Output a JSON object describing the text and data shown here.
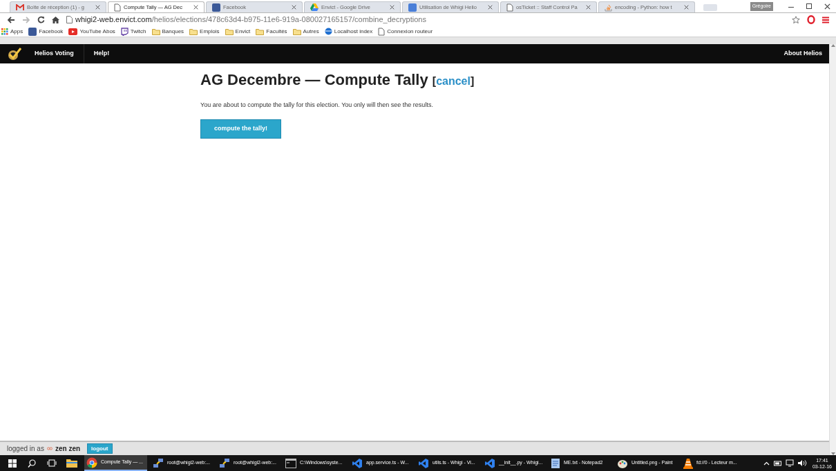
{
  "browser": {
    "tabs": [
      {
        "title": "Boîte de réception (1) - g",
        "kind": "gmail",
        "selected": false
      },
      {
        "title": "Compute Tally — AG Dec",
        "kind": "page",
        "selected": true
      },
      {
        "title": "Facebook",
        "kind": "facebook",
        "selected": false
      },
      {
        "title": "Envict - Google Drive",
        "kind": "drive",
        "selected": false
      },
      {
        "title": "Utilisation de Whigi Helio",
        "kind": "doc",
        "selected": false
      },
      {
        "title": "osTicket :: Staff Control Pa",
        "kind": "page",
        "selected": false
      },
      {
        "title": "encoding - Python: how t",
        "kind": "stack",
        "selected": false
      }
    ],
    "profile": "Grégoire",
    "url_host": "whigi2-web.envict.com",
    "url_path": "/helios/elections/478c63d4-b975-11e6-919a-080027165157/combine_decryptions",
    "bookmarks": [
      {
        "label": "Apps",
        "kind": "apps"
      },
      {
        "label": "Facebook",
        "kind": "facebook"
      },
      {
        "label": "YouTube Abos",
        "kind": "youtube"
      },
      {
        "label": "Twitch",
        "kind": "twitch"
      },
      {
        "label": "Banques",
        "kind": "folder"
      },
      {
        "label": "Emplois",
        "kind": "folder"
      },
      {
        "label": "Envict",
        "kind": "folder"
      },
      {
        "label": "Facultés",
        "kind": "folder"
      },
      {
        "label": "Autres",
        "kind": "folder"
      },
      {
        "label": "Localhost index",
        "kind": "globe"
      },
      {
        "label": "Connexion routeur",
        "kind": "page"
      }
    ]
  },
  "site_nav": {
    "brand": "Helios Voting",
    "links": [
      "Help!"
    ],
    "right": "About Helios"
  },
  "page": {
    "title": "AG Decembre — Compute Tally",
    "cancel_link": "cancel",
    "cancel_open": "[",
    "cancel_close": "]",
    "description": "You are about to compute the tally for this election. You only will then see the results.",
    "button": "compute the tally!"
  },
  "footer": {
    "prefix": "logged in as",
    "user": "zen zen",
    "logout": "logout"
  },
  "taskbar": {
    "items": [
      {
        "label": "Compute Tally — ...",
        "kind": "chrome",
        "selected": true
      },
      {
        "label": "root@whigi2-web:...",
        "kind": "putty",
        "selected": false
      },
      {
        "label": "root@whigi2-web:...",
        "kind": "putty",
        "selected": false
      },
      {
        "label": "C:\\Windows\\syste...",
        "kind": "cmd",
        "selected": false
      },
      {
        "label": "app.service.ts - W...",
        "kind": "vscode",
        "selected": false
      },
      {
        "label": "utils.ts - Whigi - Vi...",
        "kind": "vscode",
        "selected": false
      },
      {
        "label": "__init__.py - Whigi...",
        "kind": "vscode",
        "selected": false
      },
      {
        "label": "ME.txt - Notepad2",
        "kind": "notepad",
        "selected": false
      },
      {
        "label": "Untitled.png - Paint",
        "kind": "paint",
        "selected": false
      },
      {
        "label": "fd://0 - Lecteur m...",
        "kind": "vlc",
        "selected": false
      }
    ],
    "time": "17:41",
    "date": "03-12-16"
  }
}
